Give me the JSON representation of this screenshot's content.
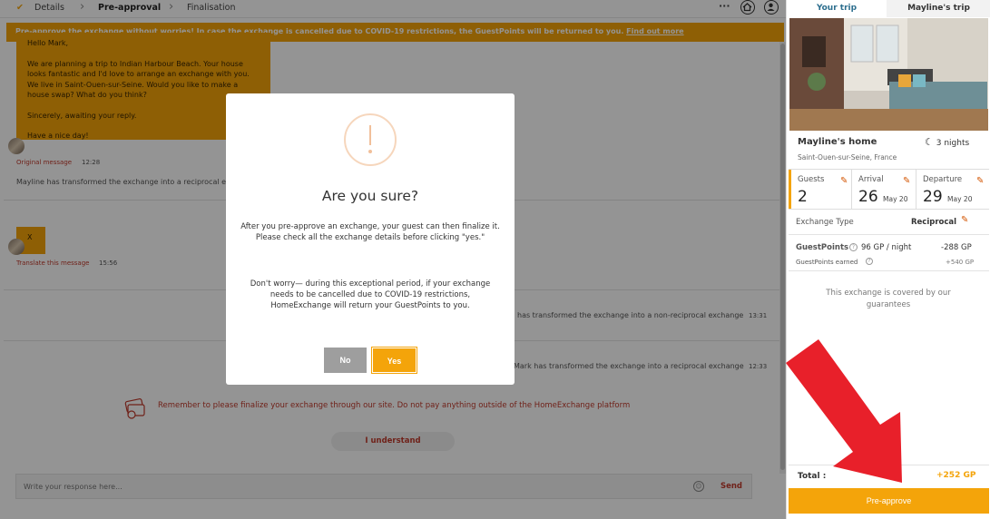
{
  "steps": [
    {
      "label": "Details",
      "state": "done"
    },
    {
      "label": "Pre-approval",
      "state": "active"
    },
    {
      "label": "Finalisation",
      "state": "pending"
    }
  ],
  "toolbar": {
    "more_icon": "ellipsis-icon",
    "home_icon": "home-icon",
    "user_icon": "user-icon"
  },
  "banner": {
    "text": "Pre-approve the exchange without worries! In case the exchange is cancelled due to COVID-19 restrictions, the GuestPoints will be returned to you.",
    "link": "Find out more"
  },
  "chat": {
    "bubble1_lines": [
      "Hello Mark,",
      "",
      "We are planning a trip to Indian Harbour Beach. Your house",
      "looks fantastic and I'd love to arrange an exchange with you.",
      "We live in Saint-Ouen-sur-Seine. Would you like to make a",
      "house swap? What do you think?",
      "",
      "Sincerely, awaiting your reply.",
      "",
      "Have a nice day!"
    ],
    "original_message": "Original message",
    "time1": "12:28",
    "sys1": "Mayline has transformed the exchange into a reciprocal exchange",
    "bubble2": "X",
    "translate": "Translate this message",
    "time2": "15:56",
    "sys2": "has transformed the exchange into a non-reciprocal exchange",
    "time3": "13:31",
    "sys3": "Mark has transformed the exchange into a reciprocal exchange",
    "time4": "12:33",
    "reminder": "Remember to please finalize your exchange through our site. Do not pay anything outside of the HomeExchange platform",
    "understand": "I understand",
    "reply_placeholder": "Write your response here...",
    "send": "Send"
  },
  "modal": {
    "title": "Are you sure?",
    "para1": "After you pre-approve an exchange, your guest can then finalize it. Please check all the exchange details before clicking \"yes.\"",
    "para2": "Don't worry— during this exceptional period, if your exchange needs to be cancelled due to COVID-19 restrictions, HomeExchange will return your GuestPoints to you.",
    "no": "No",
    "yes": "Yes"
  },
  "panel": {
    "tabs": [
      "Your trip",
      "Mayline's trip"
    ],
    "home_name": "Mayline's home",
    "nights": "3 nights",
    "location": "Saint-Ouen-sur-Seine, France",
    "guests_label": "Guests",
    "guests_value": "2",
    "arrival_label": "Arrival",
    "arrival_day": "26",
    "arrival_month": "May 20",
    "departure_label": "Departure",
    "departure_day": "29",
    "departure_month": "May 20",
    "exchange_type_label": "Exchange Type",
    "exchange_type_value": "Reciprocal",
    "gp_label": "GuestPoints",
    "gp_rate": "96 GP / night",
    "gp_cost": "-288 GP",
    "gp_earned_label": "GuestPoints earned",
    "gp_earned": "+540 GP",
    "covered": "This exchange is covered by our guarantees",
    "total_label": "Total :",
    "total_value": "+252 GP",
    "preapprove": "Pre-approve"
  },
  "colors": {
    "accent": "#f4a40a",
    "link_red": "#c0392b",
    "annotation_arrow": "#e8202a"
  }
}
